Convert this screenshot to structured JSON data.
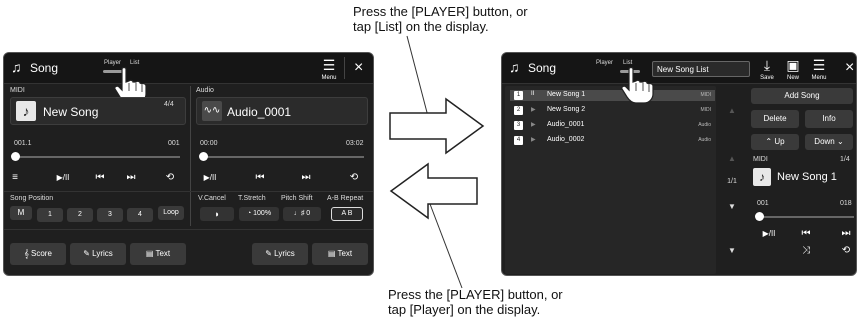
{
  "captions": {
    "top": [
      "Press the [PLAYER] button, or",
      "tap [List] on the display."
    ],
    "bottom": [
      "Press the [PLAYER] button, or",
      "tap [Player] on the display."
    ]
  },
  "left_screen": {
    "title": "Song",
    "tabs": [
      "Player",
      "List"
    ],
    "active_tab": "Player",
    "menu_label": "Menu",
    "close": "×",
    "midi": {
      "label": "MIDI",
      "song_name": "New Song",
      "count": "4/4",
      "position_start": "001.1",
      "position_end": "001",
      "progress": 0,
      "controls": [
        "≡",
        "▶/II",
        "⏮",
        "⏭",
        "⟲"
      ]
    },
    "audio": {
      "label": "Audio",
      "song_name": "Audio_0001",
      "time_start": "00:00",
      "time_end": "03:02",
      "progress": 0,
      "controls": [
        "▶/II",
        "⏮",
        "⏭",
        "⟲"
      ]
    },
    "song_position": {
      "label": "Song Position",
      "buttons": [
        "M",
        "1",
        "2",
        "3",
        "4",
        "Loop"
      ]
    },
    "audio_tools": {
      "labels": [
        "V.Cancel",
        "T.Stretch",
        "Pitch Shift",
        "A-B Repeat"
      ],
      "tstretch_value": "100%",
      "pitch_value": "0",
      "ab_value": "A B"
    },
    "bottom_buttons": [
      "Score",
      "Lyrics",
      "Text",
      "Lyrics",
      "Text"
    ]
  },
  "right_screen": {
    "title": "Song",
    "tabs": [
      "Player",
      "List"
    ],
    "active_tab": "List",
    "search_value": "New Song List",
    "toolbar": [
      "Save",
      "New",
      "Menu"
    ],
    "close": "×",
    "list": [
      {
        "num": "1",
        "name": "New Song 1",
        "type": "MIDI"
      },
      {
        "num": "2",
        "name": "New Song 2",
        "type": "MIDI"
      },
      {
        "num": "3",
        "name": "Audio_0001",
        "type": "Audio"
      },
      {
        "num": "4",
        "name": "Audio_0002",
        "type": "Audio"
      }
    ],
    "page": "1/1",
    "side_buttons": {
      "add_song": "Add Song",
      "delete": "Delete",
      "info": "Info",
      "up": "Up",
      "down": "Down"
    },
    "midi": {
      "label": "MIDI",
      "count": "1/4",
      "song_name": "New Song 1",
      "position_start": "001",
      "position_end": "018",
      "progress": 0,
      "controls": [
        "▶/II",
        "⏮",
        "⏭",
        "⤨",
        "⟲"
      ]
    }
  },
  "colors": {
    "screen_bg": "#1f1f1f",
    "titlebar_bg": "#151515",
    "panel_bg": "#2b2b2b",
    "button_bg": "#3a3a3a",
    "arrow_stroke": "#222222"
  },
  "icons": {
    "song": "music-notes-icon",
    "hand": "pointing-hand-icon",
    "arrow_right": "right-arrow-icon",
    "arrow_left": "left-arrow-icon"
  }
}
